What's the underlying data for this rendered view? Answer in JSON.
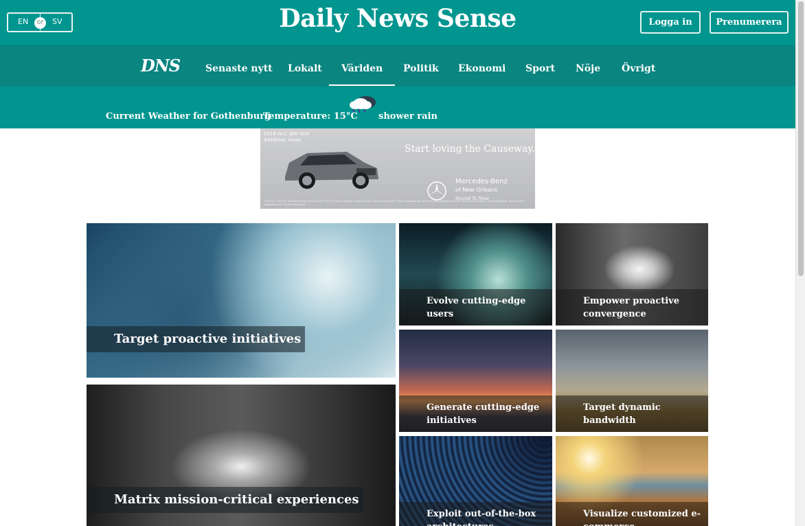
{
  "header": {
    "lang_en": "EN",
    "lang_or": "or",
    "lang_sv": "SV",
    "site_title": "Daily News Sense",
    "login_label": "Logga in",
    "subscribe_label": "Prenumerera"
  },
  "nav": {
    "logo_mark": "DNS",
    "items": [
      "Senaste nytt",
      "Lokalt",
      "Världen",
      "Politik",
      "Ekonomi",
      "Sport",
      "Nöje",
      "Övrigt"
    ],
    "active_item": "Världen"
  },
  "weather": {
    "location_label": "Current Weather for Gothenburg",
    "temperature_label": "Temperature: 15°C",
    "condition": "shower rain",
    "icon": "rain-cloud-icon"
  },
  "ad": {
    "model_line": "2018 GLC 300 SUV",
    "price_line": "$449/mo. lease",
    "slogan": "Start loving the Causeway.",
    "brand_line1": "Mercedes-Benz",
    "brand_line2": "of New Orleans",
    "brand_tagline": "Second To None",
    "fine_print": "2018 GLC 300 SUV. 36 monthly payments of $449. $2,297 due at signing includes $2,550 cap cost reduction. $795 acquisition fee and first lease payment of $449. No security deposit. Credit permitting. Plus tax and registration fee. 30,000 mile lease."
  },
  "articles": {
    "featured": [
      {
        "title": "Target proactive initiatives"
      },
      {
        "title": "Matrix mission-critical experiences"
      }
    ],
    "grid": [
      {
        "title": "Evolve cutting-edge users"
      },
      {
        "title": "Empower proactive convergence"
      },
      {
        "title": "Generate cutting-edge initiatives"
      },
      {
        "title": "Target dynamic bandwidth"
      },
      {
        "title": "Exploit out-of-the-box architectures"
      },
      {
        "title": "Visualize customized e-commerce"
      }
    ]
  },
  "colors": {
    "brand_teal": "#00958f",
    "nav_teal": "#0a8580",
    "white": "#ffffff"
  }
}
